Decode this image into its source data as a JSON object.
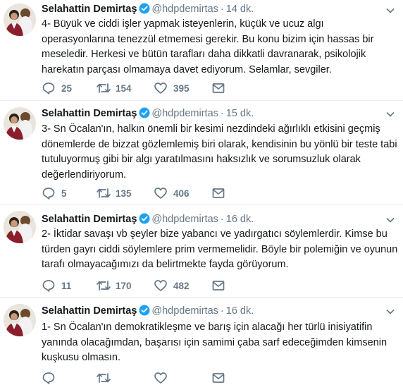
{
  "colors": {
    "verified": "#1da1f2",
    "muted": "#657786",
    "text": "#14171a",
    "divider": "#e6ecf0"
  },
  "icons": [
    "verified-badge-icon",
    "chevron-down-icon",
    "reply-icon",
    "retweet-icon",
    "like-icon",
    "direct-message-icon"
  ],
  "tweets": [
    {
      "name": "Selahattin Demirtaş",
      "handle": "@hdpdemirtas",
      "separator": "·",
      "time": "14 dk.",
      "text": "4- Büyük ve ciddi işler yapmak isteyenlerin, küçük ve ucuz algı operasyonlarına tenezzül etmemesi gerekir. Bu konu bizim için hassas bir meseledir. Herkesi ve bütün tarafları daha dikkatli davranarak, psikolojik harekatın parçası olmamaya davet ediyorum. Selamlar, sevgiler.",
      "replies": "25",
      "retweets": "154",
      "likes": "395"
    },
    {
      "name": "Selahattin Demirtaş",
      "handle": "@hdpdemirtas",
      "separator": "·",
      "time": "15 dk.",
      "text": "3- Sn Öcalan'ın, halkın önemli bir kesimi nezdindeki ağırlıklı etkisini geçmiş dönemlerde de bizzat gözlemlemiş biri olarak, kendisinin bu yönlü bir teste tabi tutuluyormuş gibi bir algı yaratılmasını haksızlık ve sorumsuzluk olarak değerlendiriyorum.",
      "replies": "5",
      "retweets": "135",
      "likes": "406"
    },
    {
      "name": "Selahattin Demirtaş",
      "handle": "@hdpdemirtas",
      "separator": "·",
      "time": "16 dk.",
      "text": "2- İktidar savaşı vb şeyler bize yabancı ve yadırgatıcı söylemlerdir. Kimse bu türden gayrı ciddi söylemlere prim vermemelidir. Böyle bir polemiğin ve oyunun tarafı olmayacağımızı da belirtmekte fayda görüyorum.",
      "replies": "11",
      "retweets": "170",
      "likes": "482"
    },
    {
      "name": "Selahattin Demirtaş",
      "handle": "@hdpdemirtas",
      "separator": "·",
      "time": "16 dk.",
      "text": "1- Sn Öcalan'ın demokratikleşme ve barış için alacağı her türlü inisiyatifin yanında olacağımdan, başarısı için samimi çaba sarf edeceğimden kimsenin kuşkusu olmasın.",
      "replies": "",
      "retweets": "",
      "likes": ""
    }
  ]
}
